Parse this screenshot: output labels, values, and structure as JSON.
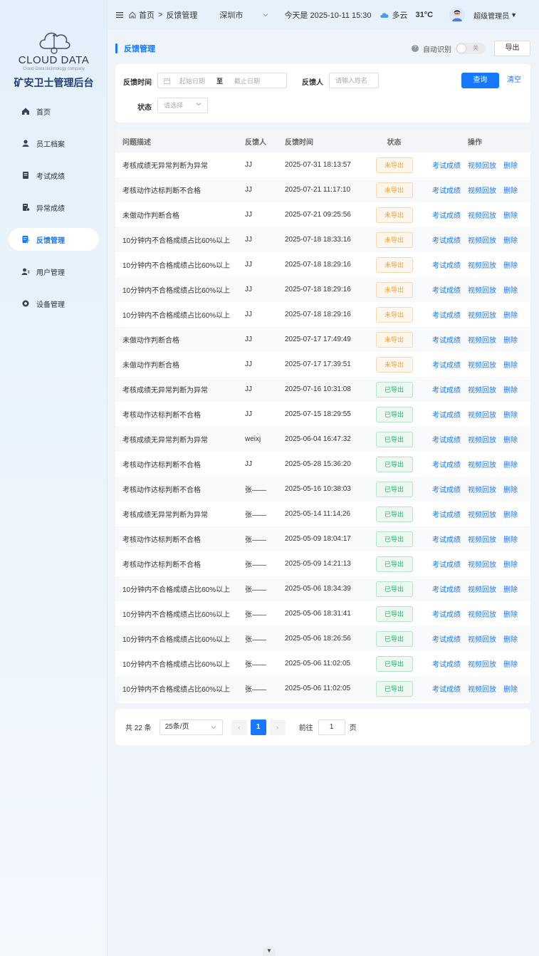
{
  "brand": {
    "logo_text": "CLOUD DATA",
    "logo_subtitle": "Cloud-Data technology company",
    "system_title": "矿安卫士管理后台"
  },
  "sidebar": {
    "items": [
      {
        "label": "首页",
        "icon": "home-icon",
        "active": false
      },
      {
        "label": "员工档案",
        "icon": "employee-icon",
        "active": false
      },
      {
        "label": "考试成绩",
        "icon": "exam-icon",
        "active": false
      },
      {
        "label": "异常成绩",
        "icon": "abnormal-icon",
        "active": false
      },
      {
        "label": "反馈管理",
        "icon": "feedback-icon",
        "active": true
      },
      {
        "label": "用户管理",
        "icon": "user-icon",
        "active": false
      },
      {
        "label": "设备管理",
        "icon": "device-icon",
        "active": false
      }
    ]
  },
  "topbar": {
    "breadcrumb_home": "首页",
    "breadcrumb_sep": ">",
    "breadcrumb_current": "反馈管理",
    "city": "深圳市",
    "today": "今天是 2025-10-11 15:30",
    "weather": "多云",
    "temperature": "31°C",
    "admin": "超级管理员",
    "admin_caret": "▼"
  },
  "page": {
    "title": "反馈管理",
    "auto_detect_label": "自动识别",
    "toggle_state": "关",
    "export_label": "导出"
  },
  "filter": {
    "time_label": "反馈时间",
    "start_placeholder": "起始日期",
    "range_sep": "至",
    "end_placeholder": "截止日期",
    "person_label": "反馈人",
    "person_placeholder": "请输入姓名",
    "query_label": "查询",
    "clear_label": "清空",
    "status_label": "状态",
    "status_placeholder": "请选择"
  },
  "table": {
    "columns": [
      "问题描述",
      "反馈人",
      "反馈时间",
      "状态",
      "操作"
    ],
    "actions": [
      "考试成绩",
      "视频回放",
      "删除"
    ],
    "rows": [
      {
        "desc": "考核成绩无异常判断为异常",
        "person": "JJ",
        "time": "2025-07-31 18:13:57",
        "status": "未导出",
        "kind": "pending"
      },
      {
        "desc": "考核动作达标判断不合格",
        "person": "JJ",
        "time": "2025-07-21 11:17:10",
        "status": "未导出",
        "kind": "pending"
      },
      {
        "desc": "未做动作判断合格",
        "person": "JJ",
        "time": "2025-07-21 09:25:56",
        "status": "未导出",
        "kind": "pending"
      },
      {
        "desc": "10分钟内不合格成绩占比60%以上",
        "person": "JJ",
        "time": "2025-07-18 18:33:16",
        "status": "未导出",
        "kind": "pending"
      },
      {
        "desc": "10分钟内不合格成绩占比60%以上",
        "person": "JJ",
        "time": "2025-07-18 18:29:16",
        "status": "未导出",
        "kind": "pending"
      },
      {
        "desc": "10分钟内不合格成绩占比60%以上",
        "person": "JJ",
        "time": "2025-07-18 18:29:16",
        "status": "未导出",
        "kind": "pending"
      },
      {
        "desc": "10分钟内不合格成绩占比60%以上",
        "person": "JJ",
        "time": "2025-07-18 18:29:16",
        "status": "未导出",
        "kind": "pending"
      },
      {
        "desc": "未做动作判断合格",
        "person": "JJ",
        "time": "2025-07-17 17:49:49",
        "status": "未导出",
        "kind": "pending"
      },
      {
        "desc": "未做动作判断合格",
        "person": "JJ",
        "time": "2025-07-17 17:39:51",
        "status": "未导出",
        "kind": "pending"
      },
      {
        "desc": "考核成绩无异常判断为异常",
        "person": "JJ",
        "time": "2025-07-16 10:31:08",
        "status": "已导出",
        "kind": "done"
      },
      {
        "desc": "考核动作达标判断不合格",
        "person": "JJ",
        "time": "2025-07-15 18:29:55",
        "status": "已导出",
        "kind": "done"
      },
      {
        "desc": "考核成绩无异常判断为异常",
        "person": "weixj",
        "time": "2025-06-04 16:47:32",
        "status": "已导出",
        "kind": "done"
      },
      {
        "desc": "考核动作达标判断不合格",
        "person": "JJ",
        "time": "2025-05-28 15:36:20",
        "status": "已导出",
        "kind": "done"
      },
      {
        "desc": "考核动作达标判断不合格",
        "person": "张——",
        "time": "2025-05-16 10:38:03",
        "status": "已导出",
        "kind": "done"
      },
      {
        "desc": "考核成绩无异常判断为异常",
        "person": "张——",
        "time": "2025-05-14 11:14:26",
        "status": "已导出",
        "kind": "done"
      },
      {
        "desc": "考核动作达标判断不合格",
        "person": "张——",
        "time": "2025-05-09 18:04:17",
        "status": "已导出",
        "kind": "done"
      },
      {
        "desc": "考核动作达标判断不合格",
        "person": "张——",
        "time": "2025-05-09 14:21:13",
        "status": "已导出",
        "kind": "done"
      },
      {
        "desc": "10分钟内不合格成绩占比60%以上",
        "person": "张——",
        "time": "2025-05-06 18:34:39",
        "status": "已导出",
        "kind": "done"
      },
      {
        "desc": "10分钟内不合格成绩占比60%以上",
        "person": "张——",
        "time": "2025-05-06 18:31:41",
        "status": "已导出",
        "kind": "done"
      },
      {
        "desc": "10分钟内不合格成绩占比60%以上",
        "person": "张——",
        "time": "2025-05-06 18:26:56",
        "status": "已导出",
        "kind": "done"
      },
      {
        "desc": "10分钟内不合格成绩占比60%以上",
        "person": "张——",
        "time": "2025-05-06 11:02:05",
        "status": "已导出",
        "kind": "done"
      },
      {
        "desc": "10分钟内不合格成绩占比60%以上",
        "person": "张——",
        "time": "2025-05-06 11:02:05",
        "status": "已导出",
        "kind": "done"
      }
    ]
  },
  "pagination": {
    "total": "共 22 条",
    "page_size": "25条/页",
    "current_page": "1",
    "goto_label": "前往",
    "goto_value": "1",
    "goto_unit": "页",
    "prev": "‹",
    "next": "›"
  },
  "colors": {
    "primary": "#1677ff",
    "pending": "#e6a23c",
    "done": "#18b566"
  },
  "scroll_indicator": "▼"
}
